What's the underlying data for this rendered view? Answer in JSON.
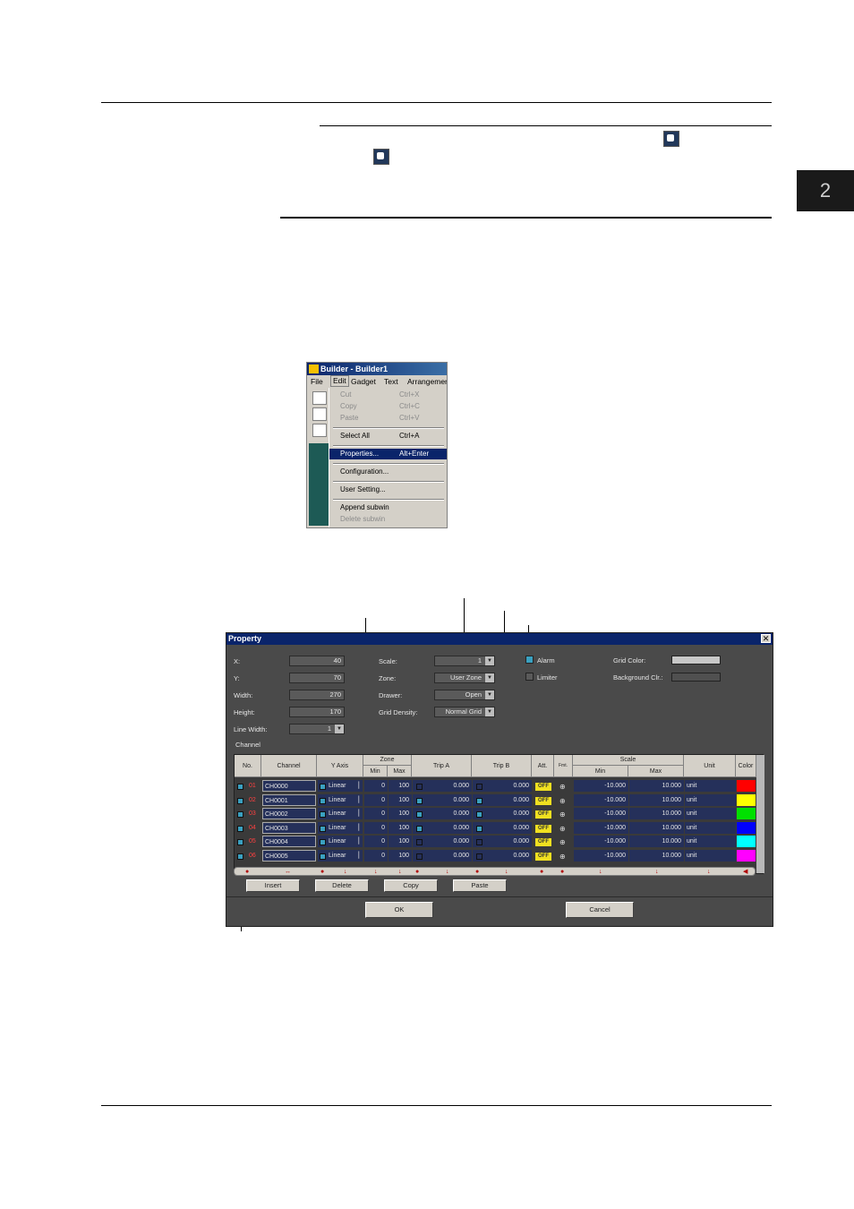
{
  "side_tab": "2",
  "builder": {
    "title": "Builder - Builder1",
    "menu": [
      "File",
      "Edit",
      "Gadget",
      "Text",
      "Arrangemen"
    ],
    "items": [
      {
        "label": "Cut",
        "shortcut": "Ctrl+X",
        "disabled": true
      },
      {
        "label": "Copy",
        "shortcut": "Ctrl+C",
        "disabled": true
      },
      {
        "label": "Paste",
        "shortcut": "Ctrl+V",
        "disabled": true
      },
      {
        "label": "Select All",
        "shortcut": "Ctrl+A"
      },
      {
        "label": "Properties...",
        "shortcut": "Alt+Enter",
        "selected": true
      },
      {
        "label": "Configuration..."
      },
      {
        "label": "User Setting..."
      },
      {
        "label": "Append subwin"
      },
      {
        "label": "Delete subwin",
        "disabled": true
      }
    ]
  },
  "property": {
    "title": "Property",
    "close": "✕",
    "fields": {
      "x_label": "X:",
      "x_value": "40",
      "y_label": "Y:",
      "y_value": "70",
      "width_label": "Width:",
      "width_value": "270",
      "height_label": "Height:",
      "height_value": "170",
      "linewidth_label": "Line Width:",
      "linewidth_value": "1",
      "scale_label": "Scale:",
      "scale_value": "1",
      "zone_label": "Zone:",
      "zone_value": "User Zone",
      "drawer_label": "Drawer:",
      "drawer_value": "Open",
      "griddensity_label": "Grid Density:",
      "griddensity_value": "Normal Grid",
      "alarm_label": "Alarm",
      "limiter_label": "Limiter",
      "gridcolor_label": "Grid Color:",
      "bgcolor_label": "Background Clr.:"
    },
    "channel_label": "Channel",
    "headers": {
      "no": "No.",
      "channel": "Channel",
      "yaxis": "Y Axis",
      "zone": "Zone",
      "zone_min": "Min",
      "zone_max": "Max",
      "tripa": "Trip A",
      "tripb": "Trip B",
      "att": "Att.",
      "fmt": "Fmt.",
      "scale": "Scale",
      "scale_min": "Min",
      "scale_max": "Max",
      "unit": "Unit",
      "color": "Color"
    },
    "rows": [
      {
        "no": "01",
        "channel": "CH0000",
        "yaxis": "Linear",
        "zmin": "0",
        "zmax": "100",
        "tripa": "0.000",
        "tripa_on": false,
        "tripb": "0.000",
        "tripb_on": false,
        "att": "OFF",
        "smin": "-10.000",
        "smax": "10.000",
        "unit": "unit",
        "color": "#ff0000"
      },
      {
        "no": "02",
        "channel": "CH0001",
        "yaxis": "Linear",
        "zmin": "0",
        "zmax": "100",
        "tripa": "0.000",
        "tripa_on": true,
        "tripb": "0.000",
        "tripb_on": true,
        "att": "OFF",
        "smin": "-10.000",
        "smax": "10.000",
        "unit": "unit",
        "color": "#ffff00"
      },
      {
        "no": "03",
        "channel": "CH0002",
        "yaxis": "Linear",
        "zmin": "0",
        "zmax": "100",
        "tripa": "0.000",
        "tripa_on": true,
        "tripb": "0.000",
        "tripb_on": true,
        "att": "OFF",
        "smin": "-10.000",
        "smax": "10.000",
        "unit": "unit",
        "color": "#00e000"
      },
      {
        "no": "04",
        "channel": "CH0003",
        "yaxis": "Linear",
        "zmin": "0",
        "zmax": "100",
        "tripa": "0.000",
        "tripa_on": true,
        "tripb": "0.000",
        "tripb_on": true,
        "att": "OFF",
        "smin": "-10.000",
        "smax": "10.000",
        "unit": "unit",
        "color": "#0000ff"
      },
      {
        "no": "05",
        "channel": "CH0004",
        "yaxis": "Linear",
        "zmin": "0",
        "zmax": "100",
        "tripa": "0.000",
        "tripa_on": false,
        "tripb": "0.000",
        "tripb_on": false,
        "att": "OFF",
        "smin": "-10.000",
        "smax": "10.000",
        "unit": "unit",
        "color": "#00ffff"
      },
      {
        "no": "06",
        "channel": "CH0005",
        "yaxis": "Linear",
        "zmin": "0",
        "zmax": "100",
        "tripa": "0.000",
        "tripa_on": false,
        "tripb": "0.000",
        "tripb_on": false,
        "att": "OFF",
        "smin": "-10.000",
        "smax": "10.000",
        "unit": "unit",
        "color": "#ff00ff"
      }
    ],
    "buttons": {
      "insert": "Insert",
      "delete": "Delete",
      "copy": "Copy",
      "paste": "Paste",
      "ok": "OK",
      "cancel": "Cancel"
    },
    "colors": {
      "grid_color": "#c8c8c8",
      "bg_color": "#505050"
    }
  }
}
